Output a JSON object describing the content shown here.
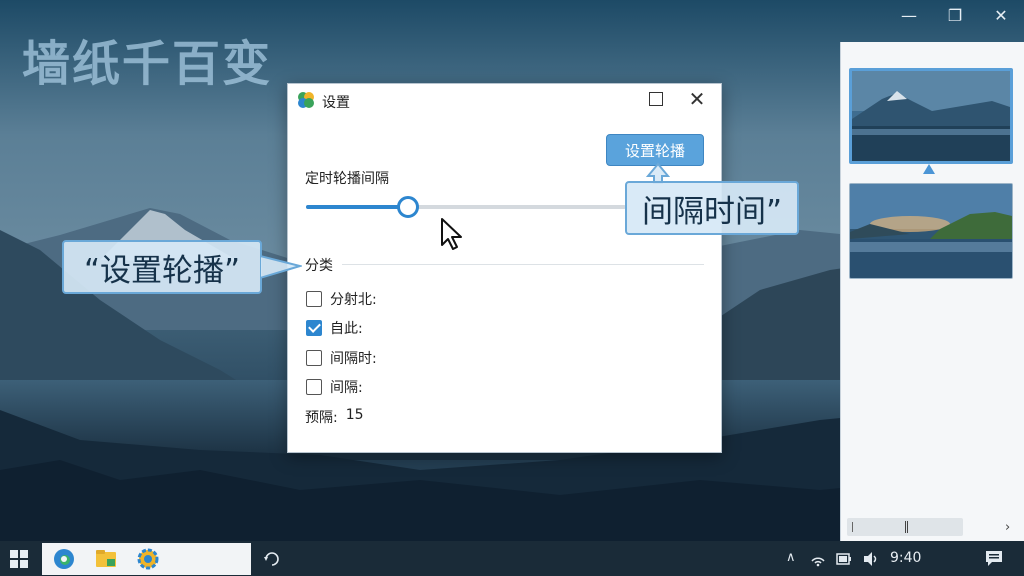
{
  "app": {
    "title": "墙纸千百变"
  },
  "main_window": {
    "minimize_glyph": "—",
    "maximize_glyph": "❐",
    "close_glyph": "✕"
  },
  "dialog": {
    "title": "设置",
    "carousel_button": "设置轮播",
    "interval_label": "定时轮播间隔",
    "interval_slider_fraction": 0.32,
    "section_label": "分类",
    "options": [
      {
        "label": "分射北:",
        "checked": false
      },
      {
        "label": "自此:",
        "checked": true
      },
      {
        "label": "间隔时:",
        "checked": false
      },
      {
        "label": "间隔:",
        "checked": false
      }
    ],
    "preview_label": "预隔:",
    "preview_value": "15",
    "close_glyph": "✕"
  },
  "callouts": {
    "left": "“设置轮播”",
    "right": "间隔时间”"
  },
  "preview_panel": {
    "scroll_arrow": "›"
  },
  "taskbar": {
    "clock": "9:40",
    "tray_arrow": "∧"
  },
  "colors": {
    "accent": "#2d86cf",
    "button": "#5aa3dc",
    "callout_border": "#6aa8d8"
  }
}
